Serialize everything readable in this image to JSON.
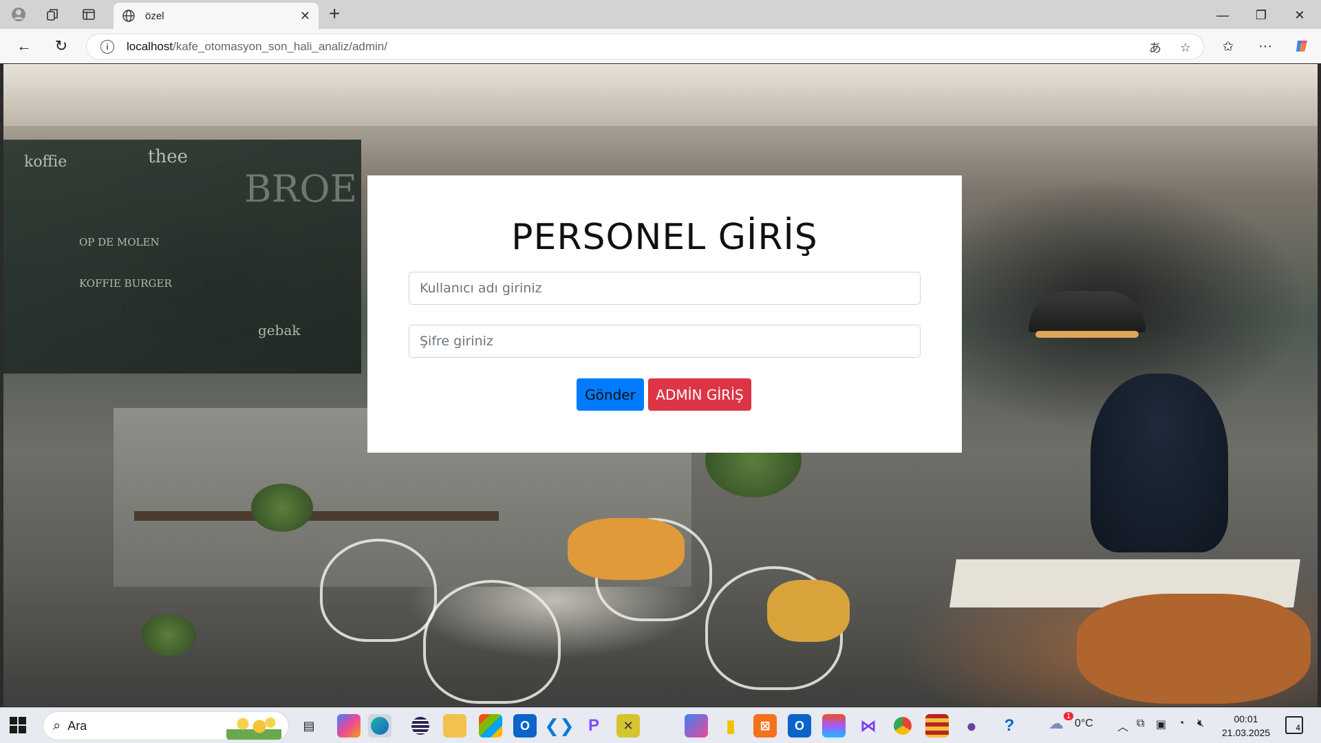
{
  "browser": {
    "tab_title": "özel",
    "url_host": "localhost",
    "url_path": "/kafe_otomasyon_son_hali_analiz/admin/"
  },
  "login": {
    "title": "PERSONEL GİRİŞ",
    "username_placeholder": "Kullanıcı adı giriniz",
    "password_placeholder": "Şifre giriniz",
    "submit_label": "Gönder",
    "admin_label": "ADMİN GİRİŞ"
  },
  "background": {
    "chalk_lines": [
      "koffie",
      "thee",
      "BROE",
      "OP DE MOLEN",
      "KOFFIE BURGER",
      "gebak"
    ]
  },
  "taskbar": {
    "search_label": "Ara",
    "weather_temp": "0°C",
    "weather_badge": "1",
    "time": "00:01",
    "date": "21.03.2025",
    "notification_count": "4"
  },
  "colors": {
    "primary": "#007bff",
    "danger": "#dc3545"
  }
}
